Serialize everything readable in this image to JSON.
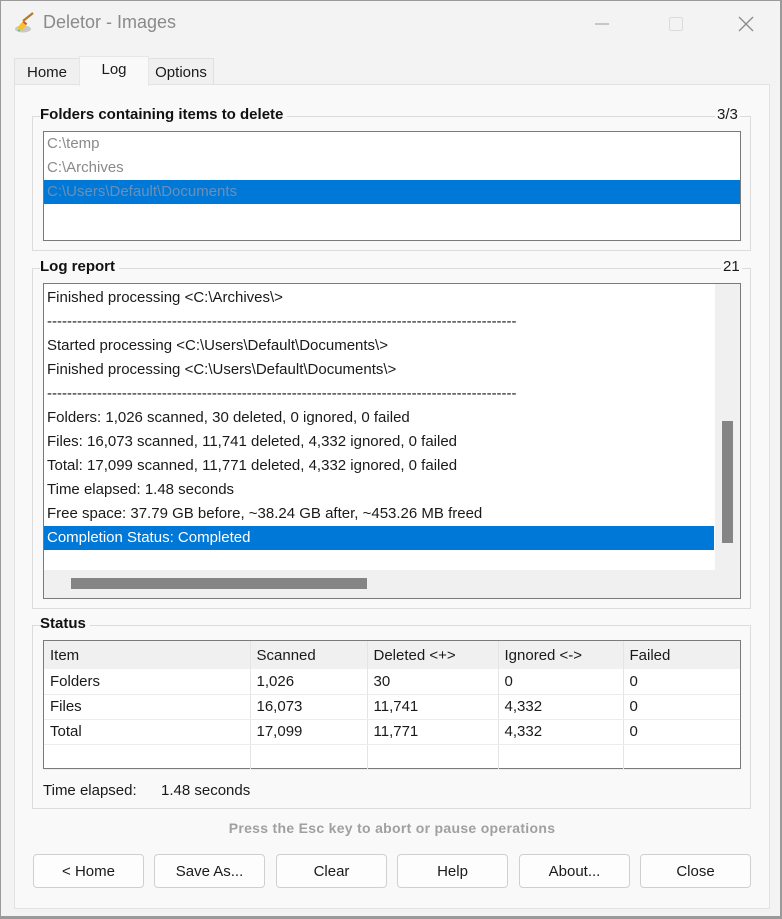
{
  "window": {
    "title": "Deletor - Images",
    "controls": {
      "minimize": "minimize",
      "maximize": "maximize",
      "close": "close"
    }
  },
  "tabs": [
    {
      "label": "Home",
      "active": false
    },
    {
      "label": "Log",
      "active": true
    },
    {
      "label": "Options",
      "active": false
    }
  ],
  "folders": {
    "label": "Folders containing items to delete",
    "count": "3/3",
    "items": [
      {
        "path": "C:\\temp",
        "selected": false
      },
      {
        "path": "C:\\Archives",
        "selected": false
      },
      {
        "path": "C:\\Users\\Default\\Documents",
        "selected": true
      }
    ]
  },
  "log": {
    "label": "Log report",
    "count": "21",
    "lines": [
      {
        "text": "Finished processing <C:\\Archives\\>",
        "selected": false
      },
      {
        "text": "----------------------------------------------------------------------------------------------",
        "selected": false
      },
      {
        "text": "Started processing <C:\\Users\\Default\\Documents\\>",
        "selected": false
      },
      {
        "text": "Finished processing <C:\\Users\\Default\\Documents\\>",
        "selected": false
      },
      {
        "text": "----------------------------------------------------------------------------------------------",
        "selected": false
      },
      {
        "text": "Folders: 1,026 scanned, 30 deleted, 0 ignored, 0 failed",
        "selected": false
      },
      {
        "text": "Files: 16,073 scanned, 11,741 deleted, 4,332 ignored, 0 failed",
        "selected": false
      },
      {
        "text": "Total: 17,099 scanned, 11,771 deleted, 4,332 ignored, 0 failed",
        "selected": false
      },
      {
        "text": "Time elapsed: 1.48 seconds",
        "selected": false
      },
      {
        "text": "Free space: 37.79 GB before, ~38.24 GB after, ~453.26 MB freed",
        "selected": false
      },
      {
        "text": "Completion Status: Completed",
        "selected": true
      }
    ]
  },
  "status": {
    "label": "Status",
    "columns": [
      "Item",
      "Scanned",
      "Deleted <+>",
      "Ignored <->",
      "Failed"
    ],
    "rows": [
      [
        "Folders",
        "1,026",
        "30",
        "0",
        "0"
      ],
      [
        "Files",
        "16,073",
        "11,741",
        "4,332",
        "0"
      ],
      [
        "Total",
        "17,099",
        "11,771",
        "4,332",
        "0"
      ],
      [
        "",
        "",
        "",
        "",
        ""
      ]
    ],
    "elapsed_label": "Time elapsed:",
    "elapsed_value": "1.48 seconds"
  },
  "hint": "Press the Esc key to abort or pause operations",
  "buttons": {
    "home": "< Home",
    "save_as": "Save As...",
    "clear": "Clear",
    "help": "Help",
    "about": "About...",
    "close": "Close"
  },
  "colors": {
    "selection": "#0078d7",
    "scroll_thumb": "#858585"
  }
}
